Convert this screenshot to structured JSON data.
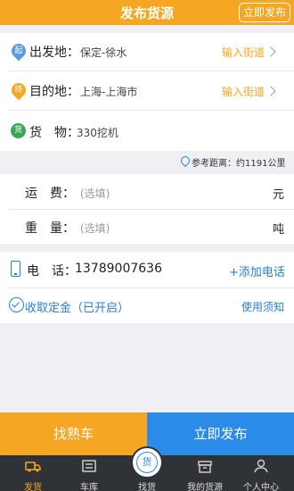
{
  "header": {
    "title": "发布货源",
    "publish_button": "立即发布"
  },
  "route": {
    "origin": {
      "icon_text": "起",
      "label": "出发地：",
      "value": "保定-徐水",
      "action": "输入街道"
    },
    "destination": {
      "icon_text": "终",
      "label": "目的地：",
      "value": "上海-上海市",
      "action": "输入街道"
    },
    "goods": {
      "icon_text": "货",
      "label": "货　物：",
      "value": "330挖机"
    }
  },
  "distance": {
    "text": "参考距离：约1191公里"
  },
  "fees": {
    "freight": {
      "label": "运　费：",
      "placeholder": "(选填)",
      "unit": "元"
    },
    "weight": {
      "label": "重　量：",
      "placeholder": "(选填)",
      "unit": "吨"
    }
  },
  "contact": {
    "label": "电　话：",
    "value": "13789007636",
    "add_label": "+添加电话"
  },
  "deposit": {
    "label": "收取定金（已开启）",
    "notice": "使用须知"
  },
  "bottom": {
    "left_button": "找熟车",
    "right_button": "立即发布"
  },
  "tabs": [
    {
      "label": "发货",
      "icon": "truck-icon",
      "active": true
    },
    {
      "label": "车库",
      "icon": "garage-icon",
      "active": false
    },
    {
      "label": "找货",
      "icon": "cargo-search-icon",
      "active": false,
      "badge": "货"
    },
    {
      "label": "我的货源",
      "icon": "box-icon",
      "active": false
    },
    {
      "label": "个人中心",
      "icon": "person-icon",
      "active": false
    }
  ],
  "colors": {
    "accent": "#f5a623",
    "blue": "#2a8ce8",
    "green": "#3aa55a",
    "tabbar": "#2f3236"
  }
}
